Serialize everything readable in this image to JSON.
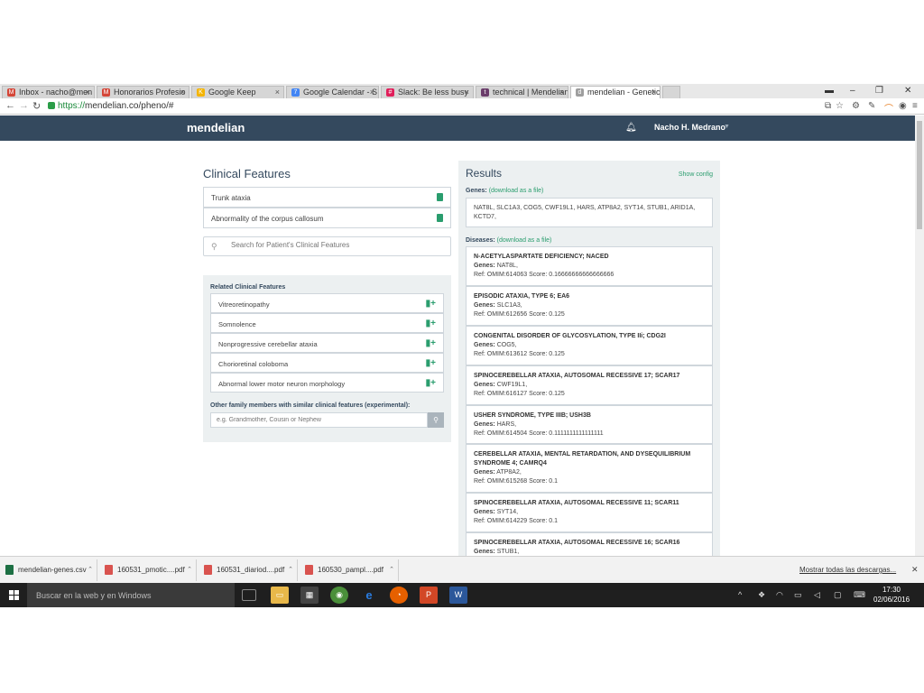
{
  "browser": {
    "tabs": [
      {
        "label": "Inbox - nacho@men",
        "color": "#d44638",
        "glyph": "M"
      },
      {
        "label": "Honorarios Profesio",
        "color": "#d44638",
        "glyph": "M"
      },
      {
        "label": "Google Keep",
        "color": "#f4b400",
        "glyph": "K"
      },
      {
        "label": "Google Calendar - S",
        "color": "#4285f4",
        "glyph": "7"
      },
      {
        "label": "Slack: Be less busy",
        "color": "#e01e5a",
        "glyph": "#"
      },
      {
        "label": "technical | Mendelian",
        "color": "#6b3d6b",
        "glyph": "t"
      },
      {
        "label": "mendelian - Genetic",
        "color": "#9e9e9e",
        "glyph": "d"
      }
    ],
    "url_secure": "https://",
    "url_rest": "mendelian.co/pheno/#"
  },
  "app": {
    "brand": "mendelian",
    "user": "Nacho H. Medrano"
  },
  "clinical": {
    "title": "Clinical Features",
    "features": [
      "Trunk ataxia",
      "Abnormality of the corpus callosum"
    ],
    "search_placeholder": "Search for Patient's Clinical Features"
  },
  "related": {
    "title": "Related Clinical Features",
    "items": [
      "Vitreoretinopathy",
      "Somnolence",
      "Nonprogressive cerebellar ataxia",
      "Chorioretinal coloboma",
      "Abnormal lower motor neuron morphology"
    ],
    "family_title": "Other family members with similar clinical features (experimental):",
    "family_placeholder": "e.g. Grandmother, Cousin or Nephew"
  },
  "results": {
    "title": "Results",
    "show_config": "Show config",
    "genes_label": "Genes:",
    "genes_link": "(download as a file)",
    "genes_text": "NAT8L, SLC1A3, COG5, CWF19L1, HARS, ATP8A2, SYT14, STUB1, ARID1A, KCTD7,",
    "diseases_label": "Diseases:",
    "diseases_link": "(download as a file)",
    "genes_prefix": "Genes:",
    "diseases": [
      {
        "name": "N-ACETYLASPARTATE DEFICIENCY; NACED",
        "genes": "NAT8L,",
        "ref": "Ref: OMIM:614063 Score: 0.16666666666666666"
      },
      {
        "name": "EPISODIC ATAXIA, TYPE 6; EA6",
        "genes": "SLC1A3,",
        "ref": "Ref: OMIM:612656 Score: 0.125"
      },
      {
        "name": "CONGENITAL DISORDER OF GLYCOSYLATION, TYPE IIi; CDG2I",
        "genes": "COG5,",
        "ref": "Ref: OMIM:613612 Score: 0.125"
      },
      {
        "name": "SPINOCEREBELLAR ATAXIA, AUTOSOMAL RECESSIVE 17; SCAR17",
        "genes": "CWF19L1,",
        "ref": "Ref: OMIM:616127 Score: 0.125"
      },
      {
        "name": "USHER SYNDROME, TYPE IIIB; USH3B",
        "genes": "HARS,",
        "ref": "Ref: OMIM:614504 Score: 0.1111111111111111"
      },
      {
        "name": "CEREBELLAR ATAXIA, MENTAL RETARDATION, AND DYSEQUILIBRIUM SYNDROME 4; CAMRQ4",
        "genes": "ATP8A2,",
        "ref": "Ref: OMIM:615268 Score: 0.1"
      },
      {
        "name": "SPINOCEREBELLAR ATAXIA, AUTOSOMAL RECESSIVE 11; SCAR11",
        "genes": "SYT14,",
        "ref": "Ref: OMIM:614229 Score: 0.1"
      },
      {
        "name": "SPINOCEREBELLAR ATAXIA, AUTOSOMAL RECESSIVE 16; SCAR16",
        "genes": "STUB1,",
        "ref": ""
      }
    ]
  },
  "downloads": {
    "items": [
      {
        "name": "mendelian-genes.csv",
        "color": "#1d7044"
      },
      {
        "name": "160531_pmotic....pdf",
        "color": "#d9534f"
      },
      {
        "name": "160531_diariod....pdf",
        "color": "#d9534f"
      },
      {
        "name": "160530_pampl....pdf",
        "color": "#d9534f"
      }
    ],
    "show_all": "Mostrar todas las descargas..."
  },
  "taskbar": {
    "search": "Buscar en la web y en Windows",
    "time": "17:30",
    "date": "02/06/2016"
  },
  "icons": {
    "bell": "bell-icon",
    "trash": "trash-icon",
    "search": "search-icon",
    "add": "add-icon"
  },
  "colors": {
    "header": "#34495e",
    "accent": "#2a9d6e"
  }
}
